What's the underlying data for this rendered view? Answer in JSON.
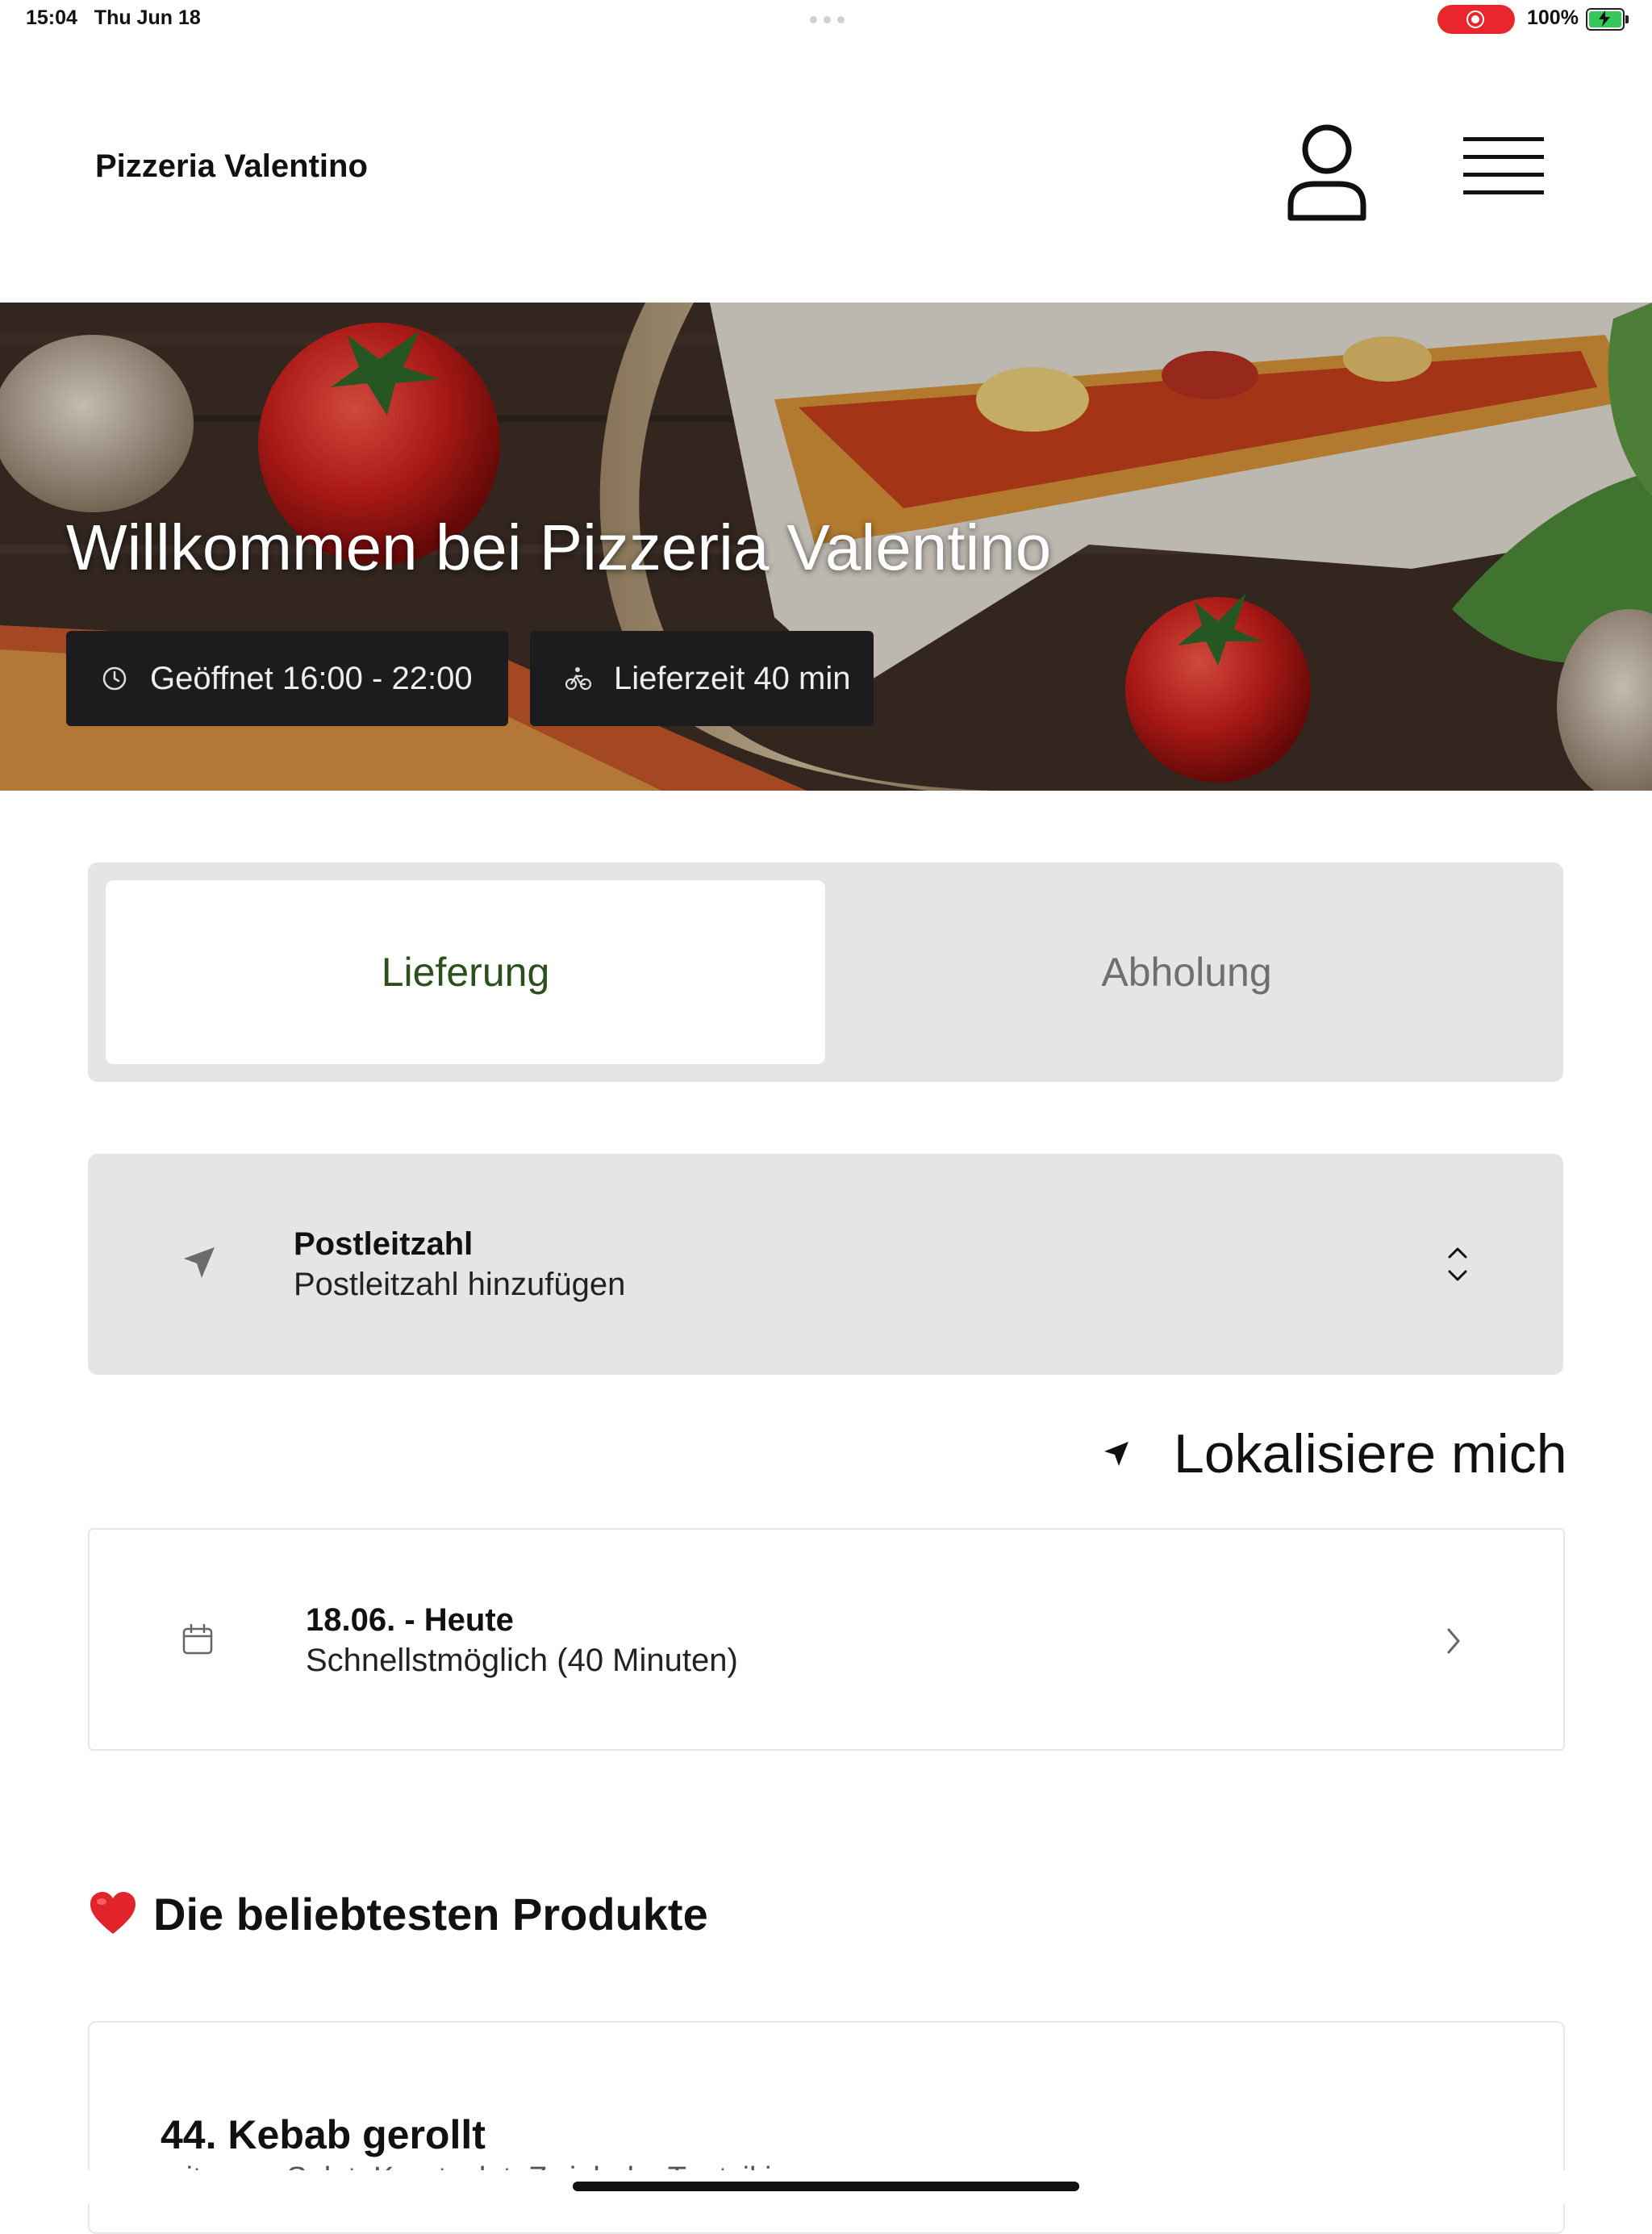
{
  "status_bar": {
    "time": "15:04",
    "date": "Thu Jun 18",
    "battery": "100%",
    "recording_color": "#e8262b",
    "battery_color": "#34c759"
  },
  "header": {
    "brand": "Pizzeria Valentino",
    "profile_icon": "person-icon",
    "menu_icon": "hamburger-menu-icon"
  },
  "hero": {
    "title": "Willkommen bei Pizzeria Valentino",
    "opening_hours": "Geöffnet 16:00 - 22:00",
    "delivery_time": "Lieferzeit 40 min",
    "opening_icon": "clock-icon",
    "delivery_icon": "bicycle-icon"
  },
  "order_mode": {
    "options": [
      "Lieferung",
      "Abholung"
    ],
    "selected": "Lieferung",
    "selected_color": "#2c4f1e"
  },
  "postal": {
    "label": "Postleitzahl",
    "placeholder": "Postleitzahl hinzufügen",
    "icon": "location-arrow-icon"
  },
  "locate": {
    "label": "Lokalisiere mich"
  },
  "schedule": {
    "date_label": "18.06. - Heute",
    "option": "Schnellstmöglich (40 Minuten)",
    "icon": "calendar-icon"
  },
  "popular": {
    "heading": "Die beliebtesten Produkte",
    "emoji": "❤️",
    "products": [
      {
        "name": "44. Kebab gerollt",
        "description": "mit gem. Salat, Krautsalat, Zwiebeln, Tzatziki"
      }
    ]
  }
}
